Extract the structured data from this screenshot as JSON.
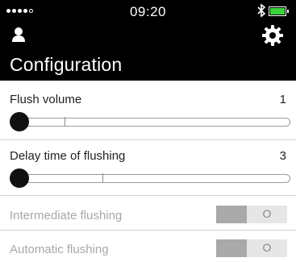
{
  "status_bar": {
    "time": "09:20"
  },
  "header": {
    "title": "Configuration"
  },
  "settings": {
    "flush_volume": {
      "label": "Flush volume",
      "value": "1"
    },
    "delay_time": {
      "label": "Delay time of flushing",
      "value": "3"
    },
    "intermediate_flushing": {
      "label": "Intermediate flushing",
      "toggle_text": "O"
    },
    "automatic_flushing": {
      "label": "Automatic flushing",
      "toggle_text": "O"
    }
  },
  "colors": {
    "header_bg": "#000000",
    "battery": "#3bd23b",
    "disabled_text": "#a7a7a7"
  },
  "icons": [
    "signal-dots-icon",
    "bluetooth-icon",
    "battery-icon",
    "user-icon",
    "gear-icon"
  ]
}
